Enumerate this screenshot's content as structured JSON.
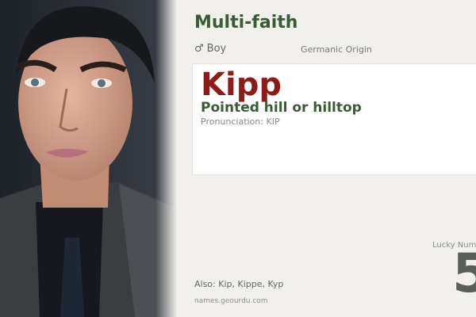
{
  "photo": {
    "icon": "portrait-photo"
  },
  "header": {
    "category": "Multi-faith",
    "gender_symbol": "♂",
    "gender": "Boy",
    "origin": "Germanic Origin"
  },
  "card": {
    "name": "Kipp",
    "meaning": "Pointed hill or hilltop",
    "pronunciation": "Pronunciation: KIP"
  },
  "lucky": {
    "label": "Lucky Number",
    "number": "5"
  },
  "footer": {
    "also": "Also: Kip, Kippe, Kyp",
    "site": "names.geourdu.com"
  },
  "colors": {
    "background": "#f1f0ec",
    "accent_green": "#3b5a36",
    "name_red": "#8e1b17"
  }
}
